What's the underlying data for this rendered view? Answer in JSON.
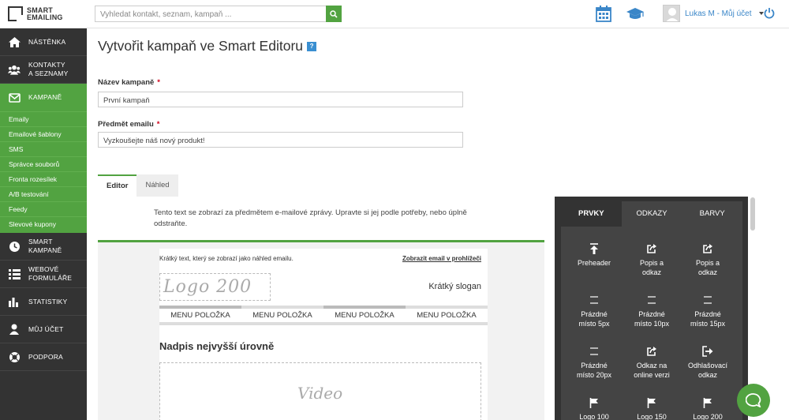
{
  "brand": {
    "line1": "SMART",
    "line2": "EMAILING"
  },
  "search": {
    "placeholder": "Vyhledat kontakt, seznam, kampaň ..."
  },
  "user": {
    "name": "Lukas M - Můj účet"
  },
  "sidebar": {
    "items": [
      {
        "label": "NÁSTĚNKA",
        "icon": "home-icon"
      },
      {
        "label1": "KONTAKTY",
        "label2": "A SEZNAMY",
        "icon": "users-icon"
      },
      {
        "label": "KAMPANĚ",
        "icon": "envelope-icon"
      },
      {
        "label1": "SMART",
        "label2": "KAMPANĚ",
        "icon": "clock-icon"
      },
      {
        "label1": "WEBOVÉ",
        "label2": "FORMULÁŘE",
        "icon": "list-icon"
      },
      {
        "label": "STATISTIKY",
        "icon": "bar-chart-icon"
      },
      {
        "label": "MŮJ ÚČET",
        "icon": "user-icon"
      },
      {
        "label": "PODPORA",
        "icon": "lifebuoy-icon"
      }
    ],
    "submenu": [
      "Emaily",
      "Emailové šablony",
      "SMS",
      "Správce souborů",
      "Fronta rozesílek",
      "A/B testování",
      "Feedy",
      "Slevové kupony"
    ]
  },
  "page": {
    "title": "Vytvořit kampaň ve Smart Editoru",
    "help": "?"
  },
  "form": {
    "name_label": "Název kampaně",
    "name_value": "První kampaň",
    "subject_label": "Předmět emailu",
    "subject_value": "Vyzkoušejte náš nový produkt!",
    "required": "*"
  },
  "tabs": [
    "Editor",
    "Náhled"
  ],
  "editor": {
    "preheader_note": "Tento text se zobrazí za předmětem e-mailové zprávy. Upravte si jej podle potřeby, nebo úplně odstraňte.",
    "preview_text": "Krátký text, který se zobrazí jako náhled emailu.",
    "browser_link": "Zobrazit email v prohlížeči",
    "logo": "Logo 200",
    "slogan": "Krátký slogan",
    "menu": [
      "MENU POLOŽKA",
      "MENU POLOŽKA",
      "MENU POLOŽKA",
      "MENU POLOŽKA"
    ],
    "heading": "Nadpis nejvyšší úrovně",
    "video": "Video"
  },
  "panel": {
    "tabs": [
      "PRVKY",
      "ODKAZY",
      "BARVY"
    ],
    "items": [
      {
        "label1": "Preheader",
        "label2": "",
        "icon": "arrow-up-bar-icon"
      },
      {
        "label1": "Popis a",
        "label2": "odkaz",
        "icon": "share-icon"
      },
      {
        "label1": "Popis a",
        "label2": "odkaz",
        "icon": "share-icon"
      },
      {
        "label1": "Prázdné",
        "label2": "místo 5px",
        "icon": "spacer-icon"
      },
      {
        "label1": "Prázdné",
        "label2": "místo 10px",
        "icon": "spacer-icon"
      },
      {
        "label1": "Prázdné",
        "label2": "místo 15px",
        "icon": "spacer-icon"
      },
      {
        "label1": "Prázdné",
        "label2": "místo 20px",
        "icon": "spacer-icon"
      },
      {
        "label1": "Odkaz na",
        "label2": "online verzi",
        "icon": "share-icon"
      },
      {
        "label1": "Odhlašovací",
        "label2": "odkaz",
        "icon": "sign-out-icon"
      },
      {
        "label1": "Logo 100",
        "label2": "",
        "icon": "flag-icon"
      },
      {
        "label1": "Logo 150",
        "label2": "",
        "icon": "flag-icon"
      },
      {
        "label1": "Logo 200",
        "label2": "",
        "icon": "flag-icon"
      }
    ]
  },
  "colors": {
    "accent": "#52a341",
    "sidebar": "#333333",
    "link": "#3a86c8"
  }
}
